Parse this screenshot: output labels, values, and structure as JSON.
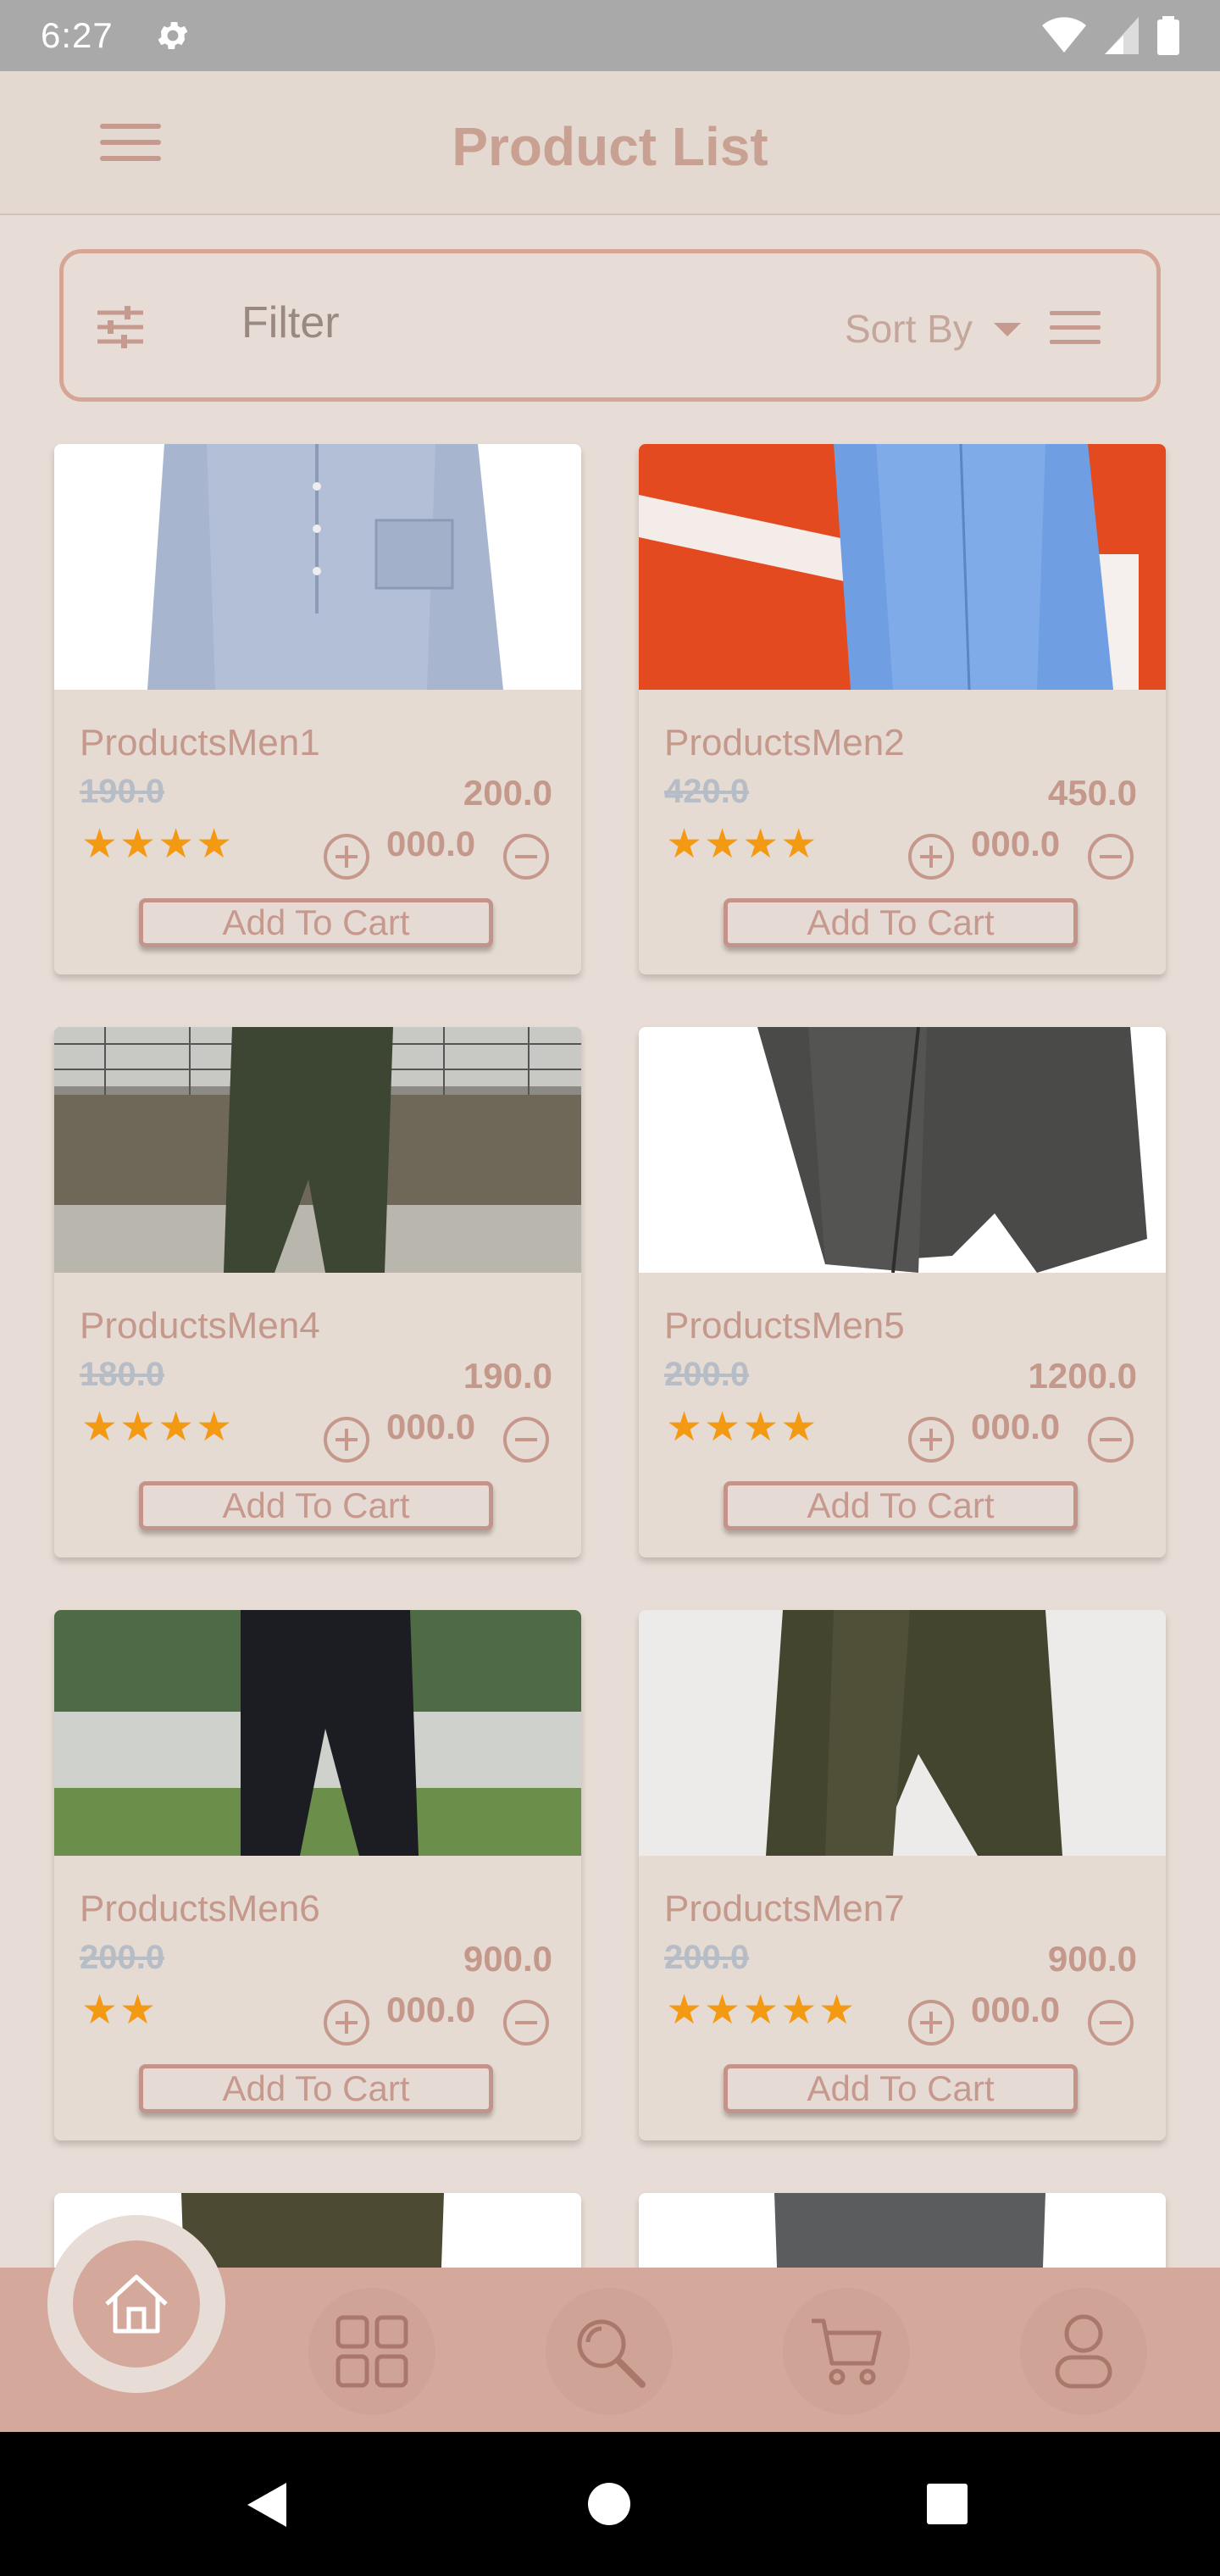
{
  "status_bar": {
    "time": "6:27",
    "icons": [
      "gear-icon",
      "wifi-icon",
      "signal-icon",
      "battery-icon"
    ]
  },
  "app_bar": {
    "title": "Product List",
    "menu_icon": "hamburger-menu-icon"
  },
  "filter_bar": {
    "filter_label": "Filter",
    "sort_label": "Sort By",
    "filter_icon": "sliders-icon",
    "sort_icon": "dropdown-caret-icon",
    "list_icon": "list-icon"
  },
  "products": [
    {
      "name": "ProductsMen1",
      "old_price": "190.0",
      "price": "200.0",
      "rating": 4,
      "stars": "★★★★",
      "qty": "000.0",
      "cart_label": "Add To Cart",
      "image": "blue-grey-shirt"
    },
    {
      "name": "ProductsMen2",
      "old_price": "420.0",
      "price": "450.0",
      "rating": 4,
      "stars": "★★★★",
      "qty": "000.0",
      "cart_label": "Add To Cart",
      "image": "blue-shirt-red-wall"
    },
    {
      "name": "ProductsMen4",
      "old_price": "180.0",
      "price": "190.0",
      "rating": 4,
      "stars": "★★★★",
      "qty": "000.0",
      "cart_label": "Add To Cart",
      "image": "olive-cargo-pants"
    },
    {
      "name": "ProductsMen5",
      "old_price": "200.0",
      "price": "1200.0",
      "rating": 4,
      "stars": "★★★★",
      "qty": "000.0",
      "cart_label": "Add To Cart",
      "image": "grey-joggers"
    },
    {
      "name": "ProductsMen6",
      "old_price": "200.0",
      "price": "900.0",
      "rating": 2,
      "stars": "★★",
      "qty": "000.0",
      "cart_label": "Add To Cart",
      "image": "black-cargo-pants"
    },
    {
      "name": "ProductsMen7",
      "old_price": "200.0",
      "price": "900.0",
      "rating": 5,
      "stars": "★★★★★",
      "qty": "000.0",
      "cart_label": "Add To Cart",
      "image": "olive-corduroy-pants"
    }
  ],
  "bottom_nav": {
    "items": [
      "home-icon",
      "grid-icon",
      "search-icon",
      "cart-icon",
      "profile-icon"
    ],
    "active": "home-icon"
  },
  "colors": {
    "accent": "#d4a99b",
    "background": "#e7ddd6",
    "star": "#f49a12",
    "text": "#c5988c"
  }
}
